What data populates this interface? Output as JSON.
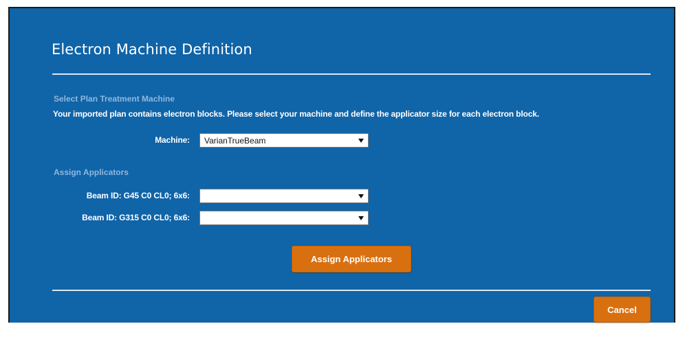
{
  "dialog": {
    "title": "Electron Machine Definition"
  },
  "machine_section": {
    "heading": "Select Plan Treatment Machine",
    "description": "Your imported plan contains electron blocks. Please select your machine and define the applicator size for each electron block.",
    "machine_label": "Machine:",
    "machine_value": "VarianTrueBeam"
  },
  "applicators_section": {
    "heading": "Assign Applicators",
    "beams": [
      {
        "label": "Beam ID: G45 C0 CL0; 6x6:",
        "value": ""
      },
      {
        "label": "Beam ID: G315 C0 CL0; 6x6:",
        "value": ""
      }
    ],
    "assign_button": "Assign Applicators"
  },
  "footer": {
    "cancel_button": "Cancel"
  },
  "colors": {
    "dialog_background": "#1064a8",
    "section_heading": "#8fb8de",
    "button": "#d9700f"
  },
  "icons": {
    "dropdown": "chevron-down-icon"
  }
}
